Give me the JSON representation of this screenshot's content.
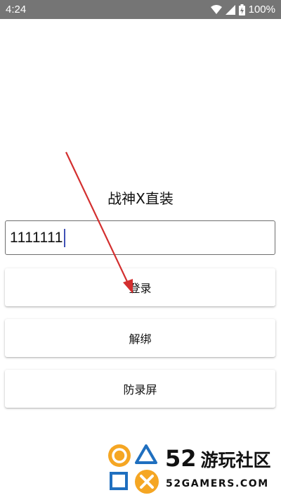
{
  "status_bar": {
    "time": "4:24",
    "battery": "100%"
  },
  "app": {
    "title": "战神X直装"
  },
  "input": {
    "value": "1111111"
  },
  "buttons": {
    "login": "登录",
    "unbind": "解绑",
    "anti_record": "防录屏"
  },
  "watermark": {
    "number": "52",
    "name": "游玩社区",
    "url": "52GAMERS.COM"
  },
  "colors": {
    "status_bar_bg": "#757575",
    "annotation_arrow": "#d32f2f",
    "caret": "#3f51b5",
    "logo_orange": "#f5a623",
    "logo_blue": "#1f6fbf"
  }
}
